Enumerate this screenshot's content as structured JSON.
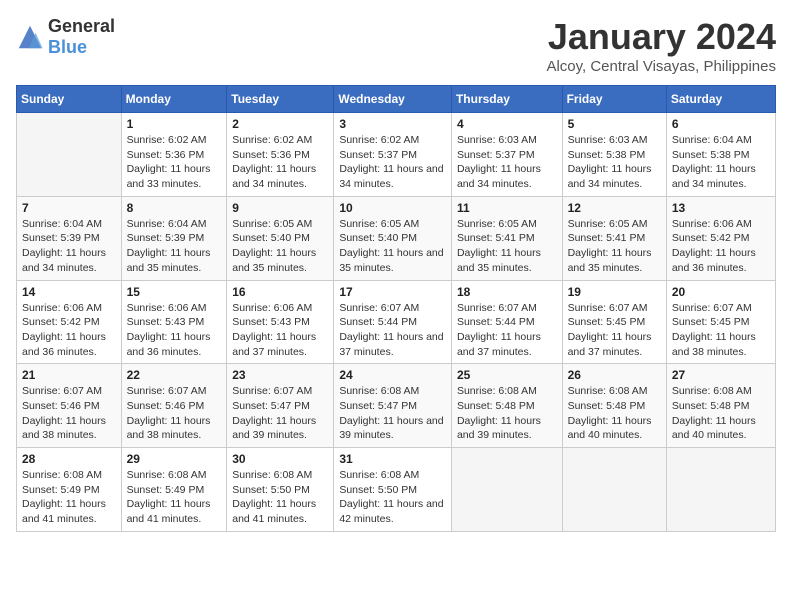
{
  "logo": {
    "text_general": "General",
    "text_blue": "Blue"
  },
  "title": "January 2024",
  "subtitle": "Alcoy, Central Visayas, Philippines",
  "days_of_week": [
    "Sunday",
    "Monday",
    "Tuesday",
    "Wednesday",
    "Thursday",
    "Friday",
    "Saturday"
  ],
  "weeks": [
    [
      {
        "day": "",
        "sunrise": "",
        "sunset": "",
        "daylight": ""
      },
      {
        "day": "1",
        "sunrise": "Sunrise: 6:02 AM",
        "sunset": "Sunset: 5:36 PM",
        "daylight": "Daylight: 11 hours and 33 minutes."
      },
      {
        "day": "2",
        "sunrise": "Sunrise: 6:02 AM",
        "sunset": "Sunset: 5:36 PM",
        "daylight": "Daylight: 11 hours and 34 minutes."
      },
      {
        "day": "3",
        "sunrise": "Sunrise: 6:02 AM",
        "sunset": "Sunset: 5:37 PM",
        "daylight": "Daylight: 11 hours and 34 minutes."
      },
      {
        "day": "4",
        "sunrise": "Sunrise: 6:03 AM",
        "sunset": "Sunset: 5:37 PM",
        "daylight": "Daylight: 11 hours and 34 minutes."
      },
      {
        "day": "5",
        "sunrise": "Sunrise: 6:03 AM",
        "sunset": "Sunset: 5:38 PM",
        "daylight": "Daylight: 11 hours and 34 minutes."
      },
      {
        "day": "6",
        "sunrise": "Sunrise: 6:04 AM",
        "sunset": "Sunset: 5:38 PM",
        "daylight": "Daylight: 11 hours and 34 minutes."
      }
    ],
    [
      {
        "day": "7",
        "sunrise": "Sunrise: 6:04 AM",
        "sunset": "Sunset: 5:39 PM",
        "daylight": "Daylight: 11 hours and 34 minutes."
      },
      {
        "day": "8",
        "sunrise": "Sunrise: 6:04 AM",
        "sunset": "Sunset: 5:39 PM",
        "daylight": "Daylight: 11 hours and 35 minutes."
      },
      {
        "day": "9",
        "sunrise": "Sunrise: 6:05 AM",
        "sunset": "Sunset: 5:40 PM",
        "daylight": "Daylight: 11 hours and 35 minutes."
      },
      {
        "day": "10",
        "sunrise": "Sunrise: 6:05 AM",
        "sunset": "Sunset: 5:40 PM",
        "daylight": "Daylight: 11 hours and 35 minutes."
      },
      {
        "day": "11",
        "sunrise": "Sunrise: 6:05 AM",
        "sunset": "Sunset: 5:41 PM",
        "daylight": "Daylight: 11 hours and 35 minutes."
      },
      {
        "day": "12",
        "sunrise": "Sunrise: 6:05 AM",
        "sunset": "Sunset: 5:41 PM",
        "daylight": "Daylight: 11 hours and 35 minutes."
      },
      {
        "day": "13",
        "sunrise": "Sunrise: 6:06 AM",
        "sunset": "Sunset: 5:42 PM",
        "daylight": "Daylight: 11 hours and 36 minutes."
      }
    ],
    [
      {
        "day": "14",
        "sunrise": "Sunrise: 6:06 AM",
        "sunset": "Sunset: 5:42 PM",
        "daylight": "Daylight: 11 hours and 36 minutes."
      },
      {
        "day": "15",
        "sunrise": "Sunrise: 6:06 AM",
        "sunset": "Sunset: 5:43 PM",
        "daylight": "Daylight: 11 hours and 36 minutes."
      },
      {
        "day": "16",
        "sunrise": "Sunrise: 6:06 AM",
        "sunset": "Sunset: 5:43 PM",
        "daylight": "Daylight: 11 hours and 37 minutes."
      },
      {
        "day": "17",
        "sunrise": "Sunrise: 6:07 AM",
        "sunset": "Sunset: 5:44 PM",
        "daylight": "Daylight: 11 hours and 37 minutes."
      },
      {
        "day": "18",
        "sunrise": "Sunrise: 6:07 AM",
        "sunset": "Sunset: 5:44 PM",
        "daylight": "Daylight: 11 hours and 37 minutes."
      },
      {
        "day": "19",
        "sunrise": "Sunrise: 6:07 AM",
        "sunset": "Sunset: 5:45 PM",
        "daylight": "Daylight: 11 hours and 37 minutes."
      },
      {
        "day": "20",
        "sunrise": "Sunrise: 6:07 AM",
        "sunset": "Sunset: 5:45 PM",
        "daylight": "Daylight: 11 hours and 38 minutes."
      }
    ],
    [
      {
        "day": "21",
        "sunrise": "Sunrise: 6:07 AM",
        "sunset": "Sunset: 5:46 PM",
        "daylight": "Daylight: 11 hours and 38 minutes."
      },
      {
        "day": "22",
        "sunrise": "Sunrise: 6:07 AM",
        "sunset": "Sunset: 5:46 PM",
        "daylight": "Daylight: 11 hours and 38 minutes."
      },
      {
        "day": "23",
        "sunrise": "Sunrise: 6:07 AM",
        "sunset": "Sunset: 5:47 PM",
        "daylight": "Daylight: 11 hours and 39 minutes."
      },
      {
        "day": "24",
        "sunrise": "Sunrise: 6:08 AM",
        "sunset": "Sunset: 5:47 PM",
        "daylight": "Daylight: 11 hours and 39 minutes."
      },
      {
        "day": "25",
        "sunrise": "Sunrise: 6:08 AM",
        "sunset": "Sunset: 5:48 PM",
        "daylight": "Daylight: 11 hours and 39 minutes."
      },
      {
        "day": "26",
        "sunrise": "Sunrise: 6:08 AM",
        "sunset": "Sunset: 5:48 PM",
        "daylight": "Daylight: 11 hours and 40 minutes."
      },
      {
        "day": "27",
        "sunrise": "Sunrise: 6:08 AM",
        "sunset": "Sunset: 5:48 PM",
        "daylight": "Daylight: 11 hours and 40 minutes."
      }
    ],
    [
      {
        "day": "28",
        "sunrise": "Sunrise: 6:08 AM",
        "sunset": "Sunset: 5:49 PM",
        "daylight": "Daylight: 11 hours and 41 minutes."
      },
      {
        "day": "29",
        "sunrise": "Sunrise: 6:08 AM",
        "sunset": "Sunset: 5:49 PM",
        "daylight": "Daylight: 11 hours and 41 minutes."
      },
      {
        "day": "30",
        "sunrise": "Sunrise: 6:08 AM",
        "sunset": "Sunset: 5:50 PM",
        "daylight": "Daylight: 11 hours and 41 minutes."
      },
      {
        "day": "31",
        "sunrise": "Sunrise: 6:08 AM",
        "sunset": "Sunset: 5:50 PM",
        "daylight": "Daylight: 11 hours and 42 minutes."
      },
      {
        "day": "",
        "sunrise": "",
        "sunset": "",
        "daylight": ""
      },
      {
        "day": "",
        "sunrise": "",
        "sunset": "",
        "daylight": ""
      },
      {
        "day": "",
        "sunrise": "",
        "sunset": "",
        "daylight": ""
      }
    ]
  ]
}
